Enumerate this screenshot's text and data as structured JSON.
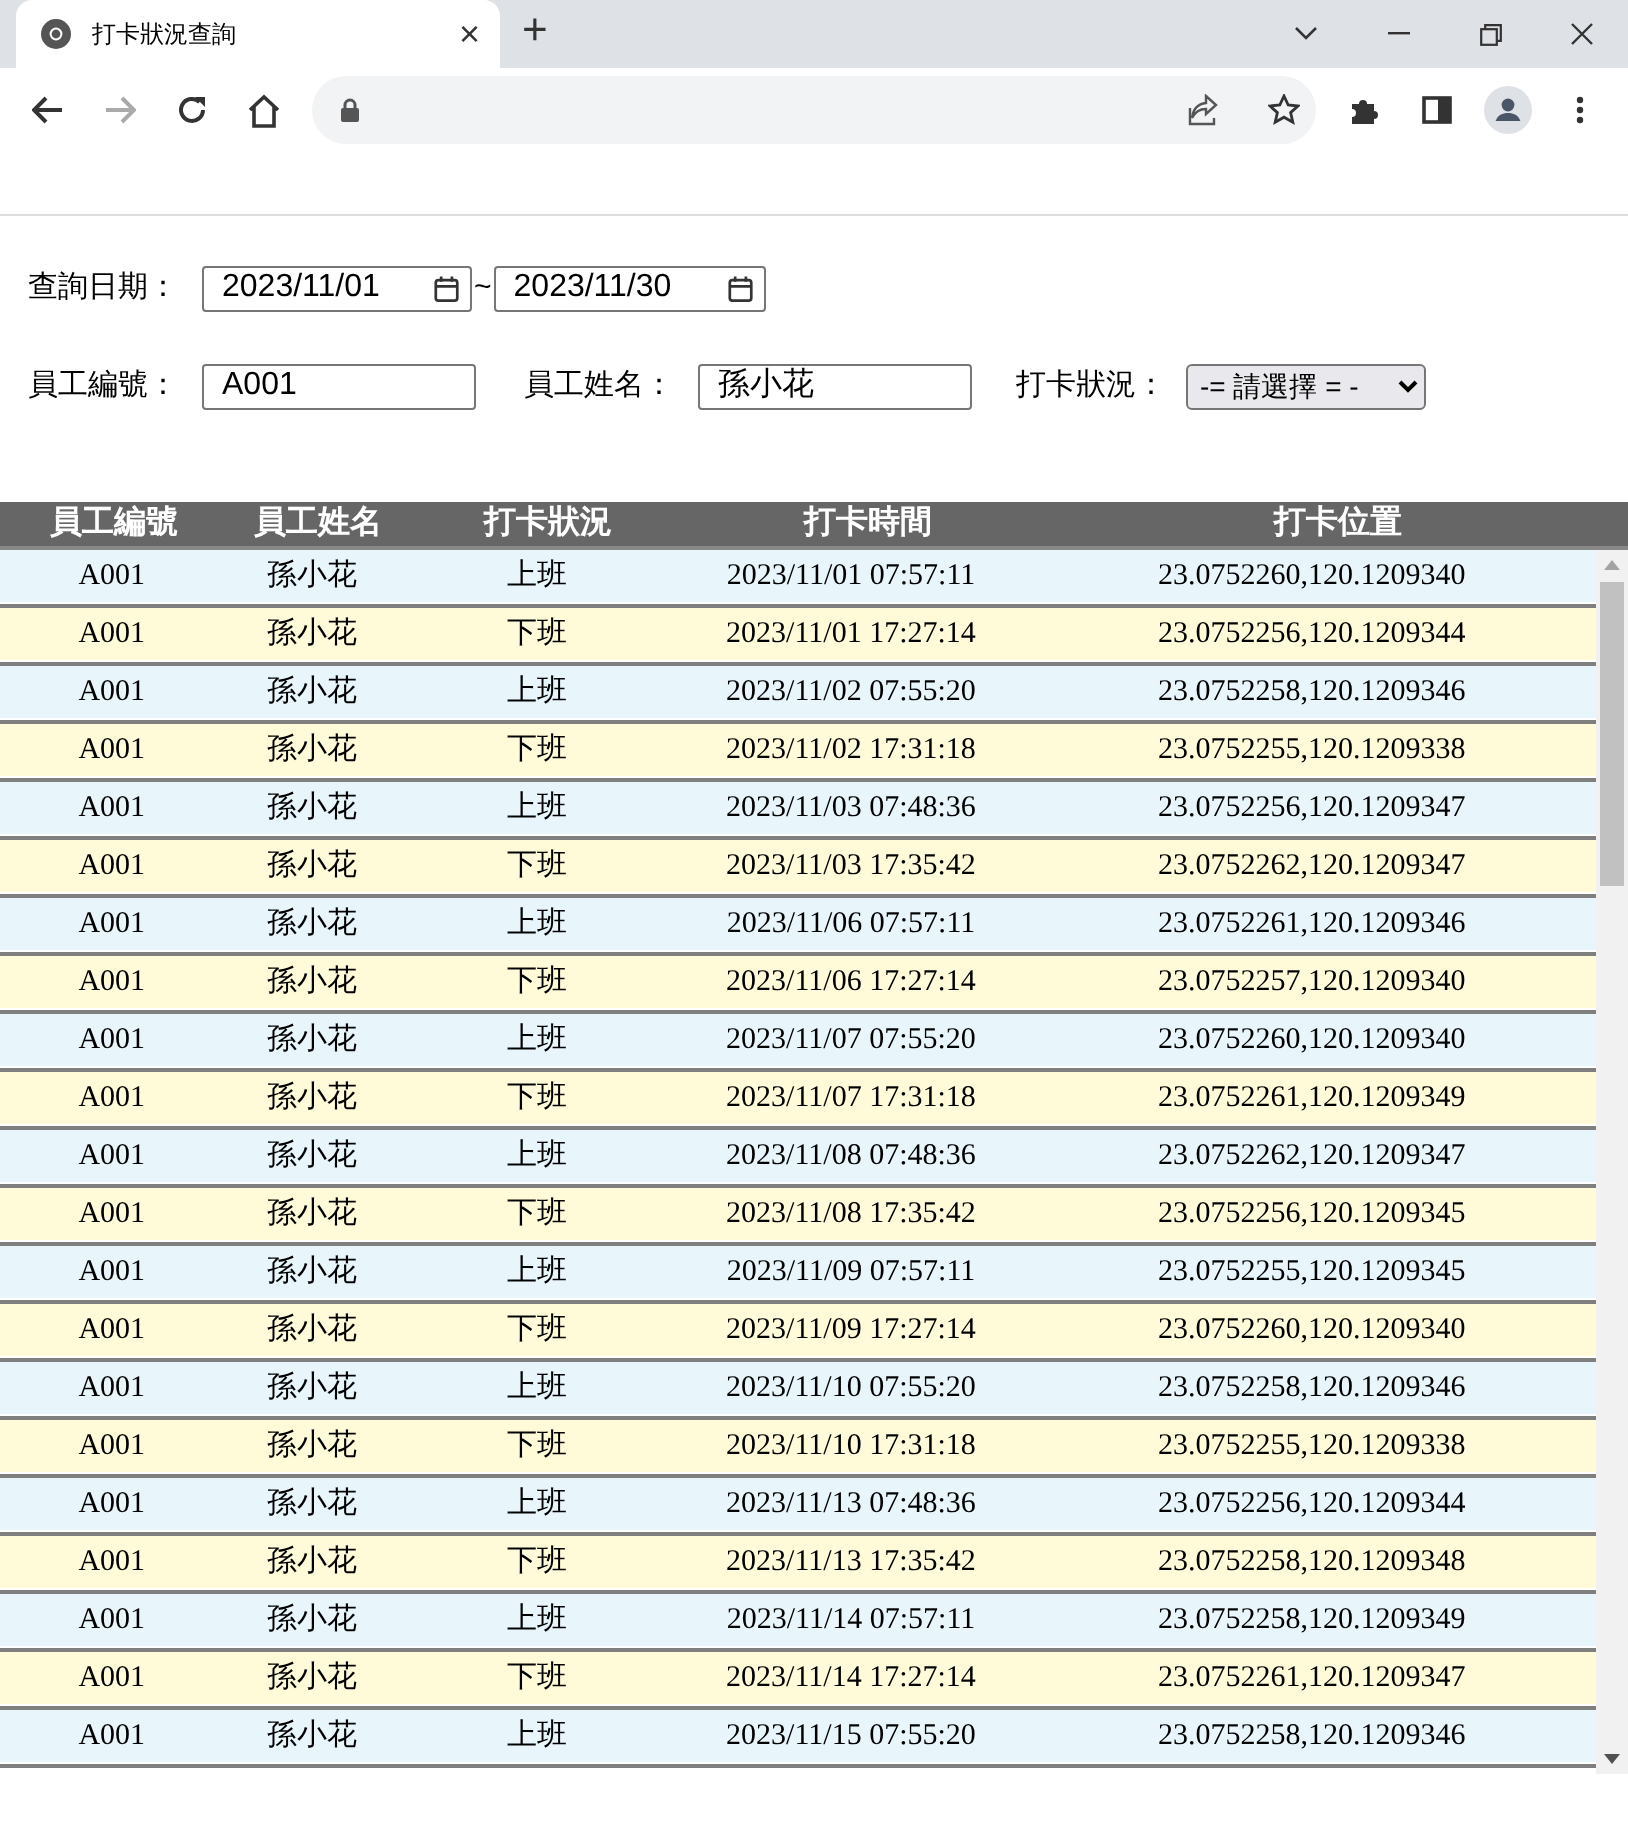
{
  "browser": {
    "tab_title": "打卡狀況查詢",
    "tab_close": "×",
    "new_tab": "+"
  },
  "query": {
    "date_label": "查詢日期：",
    "date_from": "2023/11/01",
    "separator": "~",
    "date_to": "2023/11/30",
    "employee_id_label": "員工編號：",
    "employee_id": "A001",
    "employee_name_label": "員工姓名：",
    "employee_name": "孫小花",
    "status_label": "打卡狀況：",
    "status_value": "-= 請選擇 = -"
  },
  "table": {
    "columns": [
      "員工編號",
      "員工姓名",
      "打卡狀況",
      "打卡時間",
      "打卡位置"
    ],
    "rows": [
      {
        "cells": [
          "A001",
          "孫小花",
          "上班",
          "2023/11/01 07:57:11",
          "23.0752260,120.1209340"
        ],
        "color": "#e8f5fb"
      },
      {
        "cells": [
          "A001",
          "孫小花",
          "下班",
          "2023/11/01 17:27:14",
          "23.0752256,120.1209344"
        ],
        "color": "#fffbd9"
      },
      {
        "cells": [
          "A001",
          "孫小花",
          "上班",
          "2023/11/02 07:55:20",
          "23.0752258,120.1209346"
        ],
        "color": "#e8f5fb"
      },
      {
        "cells": [
          "A001",
          "孫小花",
          "下班",
          "2023/11/02 17:31:18",
          "23.0752255,120.1209338"
        ],
        "color": "#fffbd9"
      },
      {
        "cells": [
          "A001",
          "孫小花",
          "上班",
          "2023/11/03 07:48:36",
          "23.0752256,120.1209347"
        ],
        "color": "#e8f5fb"
      },
      {
        "cells": [
          "A001",
          "孫小花",
          "下班",
          "2023/11/03 17:35:42",
          "23.0752262,120.1209347"
        ],
        "color": "#fffbd9"
      },
      {
        "cells": [
          "A001",
          "孫小花",
          "上班",
          "2023/11/06 07:57:11",
          "23.0752261,120.1209346"
        ],
        "color": "#e8f5fb"
      },
      {
        "cells": [
          "A001",
          "孫小花",
          "下班",
          "2023/11/06 17:27:14",
          "23.0752257,120.1209340"
        ],
        "color": "#fffbd9"
      },
      {
        "cells": [
          "A001",
          "孫小花",
          "上班",
          "2023/11/07 07:55:20",
          "23.0752260,120.1209340"
        ],
        "color": "#e8f5fb"
      },
      {
        "cells": [
          "A001",
          "孫小花",
          "下班",
          "2023/11/07 17:31:18",
          "23.0752261,120.1209349"
        ],
        "color": "#fffbd9"
      },
      {
        "cells": [
          "A001",
          "孫小花",
          "上班",
          "2023/11/08 07:48:36",
          "23.0752262,120.1209347"
        ],
        "color": "#e8f5fb"
      },
      {
        "cells": [
          "A001",
          "孫小花",
          "下班",
          "2023/11/08 17:35:42",
          "23.0752256,120.1209345"
        ],
        "color": "#fffbd9"
      },
      {
        "cells": [
          "A001",
          "孫小花",
          "上班",
          "2023/11/09 07:57:11",
          "23.0752255,120.1209345"
        ],
        "color": "#e8f5fb"
      },
      {
        "cells": [
          "A001",
          "孫小花",
          "下班",
          "2023/11/09 17:27:14",
          "23.0752260,120.1209340"
        ],
        "color": "#fffbd9"
      },
      {
        "cells": [
          "A001",
          "孫小花",
          "上班",
          "2023/11/10 07:55:20",
          "23.0752258,120.1209346"
        ],
        "color": "#e8f5fb"
      },
      {
        "cells": [
          "A001",
          "孫小花",
          "下班",
          "2023/11/10 17:31:18",
          "23.0752255,120.1209338"
        ],
        "color": "#fffbd9"
      },
      {
        "cells": [
          "A001",
          "孫小花",
          "上班",
          "2023/11/13 07:48:36",
          "23.0752256,120.1209344"
        ],
        "color": "#e8f5fb"
      },
      {
        "cells": [
          "A001",
          "孫小花",
          "下班",
          "2023/11/13 17:35:42",
          "23.0752258,120.1209348"
        ],
        "color": "#fffbd9"
      },
      {
        "cells": [
          "A001",
          "孫小花",
          "上班",
          "2023/11/14 07:57:11",
          "23.0752258,120.1209349"
        ],
        "color": "#e8f5fb"
      },
      {
        "cells": [
          "A001",
          "孫小花",
          "下班",
          "2023/11/14 17:27:14",
          "23.0752261,120.1209347"
        ],
        "color": "#fffbd9"
      },
      {
        "cells": [
          "A001",
          "孫小花",
          "上班",
          "2023/11/15 07:55:20",
          "23.0752258,120.1209346"
        ],
        "color": "#e8f5fb"
      }
    ]
  }
}
